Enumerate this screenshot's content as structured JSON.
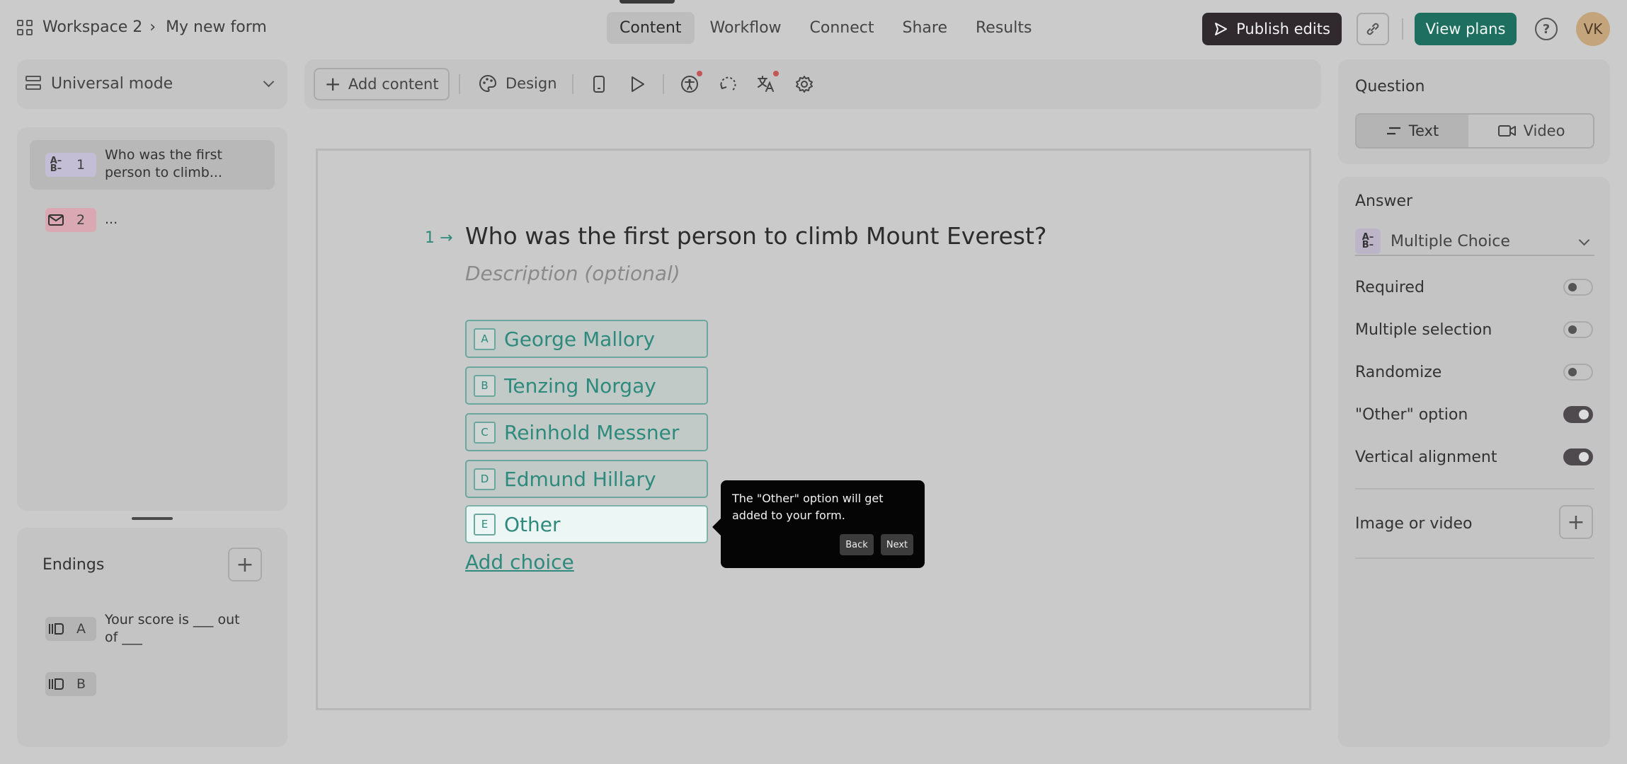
{
  "header": {
    "workspace": "Workspace 2",
    "breadcrumb_sep": "›",
    "form_name": "My new form",
    "tabs": [
      "Content",
      "Workflow",
      "Connect",
      "Share",
      "Results"
    ],
    "active_tab": "Content",
    "publish_label": "Publish edits",
    "view_plans_label": "View plans",
    "help_glyph": "?",
    "avatar_initials": "VK"
  },
  "sidebar": {
    "mode_label": "Universal mode",
    "questions": [
      {
        "num": "1",
        "text": "Who was the first person to climb...",
        "type_icon": "multiple-choice-icon",
        "color": "#c3bdd6"
      },
      {
        "num": "2",
        "text": "...",
        "type_icon": "email-icon",
        "color": "#d9a8b2"
      }
    ],
    "endings_title": "Endings",
    "endings": [
      {
        "key": "A",
        "text": "Your score is ___ out of ___"
      },
      {
        "key": "B",
        "text": ""
      }
    ]
  },
  "toolbar": {
    "add_content_label": "Add content",
    "design_label": "Design"
  },
  "canvas": {
    "question_number": "1",
    "question_title": "Who was the first person to climb Mount Everest?",
    "description_placeholder": "Description (optional)",
    "choices": [
      {
        "key": "A",
        "label": "George Mallory"
      },
      {
        "key": "B",
        "label": "Tenzing Norgay"
      },
      {
        "key": "C",
        "label": "Reinhold Messner"
      },
      {
        "key": "D",
        "label": "Edmund Hillary"
      },
      {
        "key": "E",
        "label": "Other"
      }
    ],
    "add_choice_label": "Add choice",
    "accent_color": "#2d8a7c"
  },
  "tooltip": {
    "text": "The \"Other\" option will get added to your form.",
    "back_label": "Back",
    "next_label": "Next"
  },
  "right_panel": {
    "question_heading": "Question",
    "text_label": "Text",
    "video_label": "Video",
    "answer_heading": "Answer",
    "answer_type": "Multiple Choice",
    "settings": [
      {
        "label": "Required",
        "on": false
      },
      {
        "label": "Multiple selection",
        "on": false
      },
      {
        "label": "Randomize",
        "on": false
      },
      {
        "label": "\"Other\" option",
        "on": true
      },
      {
        "label": "Vertical alignment",
        "on": true
      }
    ],
    "image_video_label": "Image or video"
  }
}
